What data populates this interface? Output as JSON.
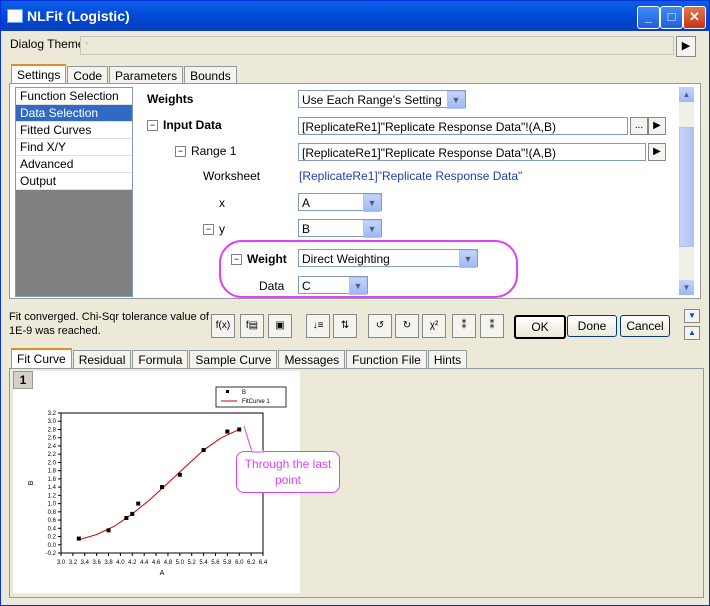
{
  "window": {
    "title": "NLFit (Logistic)"
  },
  "theme": {
    "label": "Dialog Theme",
    "value": "*"
  },
  "top_tabs": [
    "Settings",
    "Code",
    "Parameters",
    "Bounds"
  ],
  "nav_items": [
    "Function Selection",
    "Data Selection",
    "Fitted Curves",
    "Find X/Y",
    "Advanced",
    "Output"
  ],
  "props": {
    "weights_label": "Weights",
    "weights_value": "Use Each Range's Setting",
    "input_data_label": "Input Data",
    "input_data_value": "[ReplicateRe1]\"Replicate Response Data\"!(A,B)",
    "range1_label": "Range 1",
    "range1_value": "[ReplicateRe1]\"Replicate Response Data\"!(A,B)",
    "worksheet_label": "Worksheet",
    "worksheet_value": "[ReplicateRe1]\"Replicate Response Data\"",
    "x_label": "x",
    "x_value": "A",
    "y_label": "y",
    "y_value": "B",
    "weight_label": "Weight",
    "weight_value": "Direct Weighting",
    "data_label": "Data",
    "data_value": "C",
    "browse": "..."
  },
  "status_text": "Fit converged. Chi-Sqr tolerance value of 1E-9 was reached.",
  "buttons": {
    "ok": "OK",
    "done": "Done",
    "cancel": "Cancel"
  },
  "bottom_tabs": [
    "Fit Curve",
    "Residual",
    "Formula",
    "Sample Curve",
    "Messages",
    "Function File",
    "Hints"
  ],
  "page_number": "1",
  "callout": "Through the last point",
  "colors": {
    "highlight": "#e040fb",
    "curve": "#cc0000",
    "accent": "#316ac5"
  },
  "chart_data": {
    "type": "scatter",
    "xlabel": "A",
    "ylabel": "B",
    "xlim": [
      3.0,
      6.4
    ],
    "ylim": [
      -0.2,
      3.2
    ],
    "xticks": [
      "3.0",
      "3.2",
      "3.4",
      "3.6",
      "3.8",
      "4.0",
      "4.2",
      "4.4",
      "4.6",
      "4.8",
      "5.0",
      "5.2",
      "5.4",
      "5.6",
      "5.8",
      "6.0",
      "6.2",
      "6.4"
    ],
    "yticks": [
      "-0.2",
      "0.0",
      "0.2",
      "0.4",
      "0.6",
      "0.8",
      "1.0",
      "1.2",
      "1.4",
      "1.6",
      "1.8",
      "2.0",
      "2.2",
      "2.4",
      "2.6",
      "2.8",
      "3.0",
      "3.2"
    ],
    "legend": [
      "B",
      "FitCurve 1"
    ],
    "points": [
      [
        3.3,
        0.15
      ],
      [
        3.8,
        0.35
      ],
      [
        4.1,
        0.65
      ],
      [
        4.2,
        0.75
      ],
      [
        4.3,
        1.0
      ],
      [
        4.7,
        1.4
      ],
      [
        5.0,
        1.7
      ],
      [
        5.4,
        2.3
      ],
      [
        5.8,
        2.75
      ],
      [
        6.0,
        2.8
      ]
    ],
    "curve": [
      [
        3.3,
        0.12
      ],
      [
        3.6,
        0.25
      ],
      [
        3.9,
        0.45
      ],
      [
        4.2,
        0.75
      ],
      [
        4.5,
        1.1
      ],
      [
        4.8,
        1.5
      ],
      [
        5.1,
        1.9
      ],
      [
        5.4,
        2.3
      ],
      [
        5.7,
        2.6
      ],
      [
        6.0,
        2.8
      ]
    ]
  }
}
